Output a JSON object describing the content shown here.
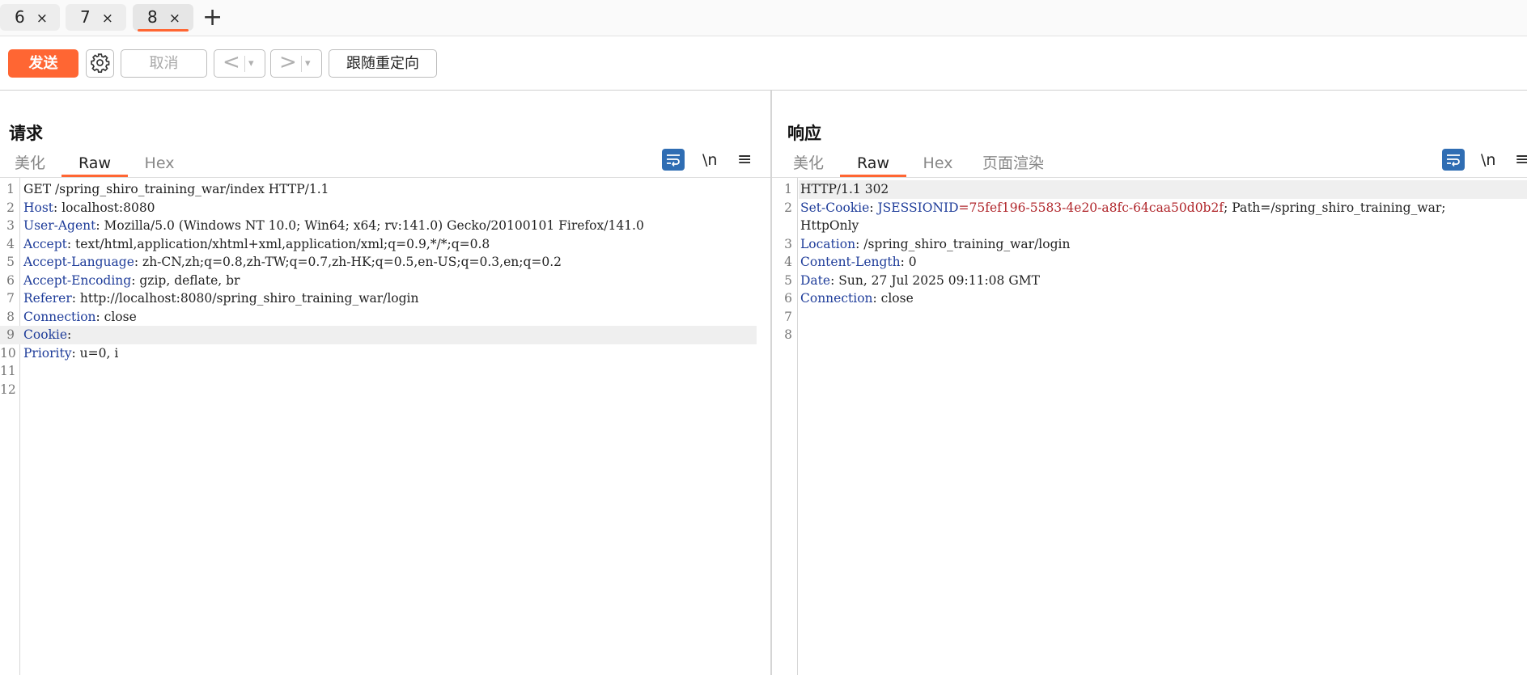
{
  "tabs": [
    {
      "label": "6",
      "close": "×"
    },
    {
      "label": "7",
      "close": "×"
    },
    {
      "label": "8",
      "close": "×"
    }
  ],
  "tab_add": "+",
  "toolbar": {
    "send": "发送",
    "cancel": "取消",
    "back": "<",
    "forward": ">",
    "dropdown": "▾",
    "follow_redirect": "跟随重定向"
  },
  "request": {
    "title": "请求",
    "tabs": [
      "美化",
      "Raw",
      "Hex"
    ],
    "active_tab": "Raw",
    "newline_label": "\\n",
    "menu_label": "≡",
    "lines": [
      {
        "n": "1",
        "text": "GET /spring_shiro_training_war/index HTTP/1.1"
      },
      {
        "n": "2",
        "key": "Host",
        "sep": ": ",
        "value": "localhost:8080"
      },
      {
        "n": "3",
        "key": "User-Agent",
        "sep": ": ",
        "value": "Mozilla/5.0 (Windows NT 10.0; Win64; x64; rv:141.0) Gecko/20100101 Firefox/141.0"
      },
      {
        "n": "4",
        "key": "Accept",
        "sep": ": ",
        "value": "text/html,application/xhtml+xml,application/xml;q=0.9,*/*;q=0.8"
      },
      {
        "n": "5",
        "key": "Accept-Language",
        "sep": ": ",
        "value": "zh-CN,zh;q=0.8,zh-TW;q=0.7,zh-HK;q=0.5,en-US;q=0.3,en;q=0.2"
      },
      {
        "n": "6",
        "key": "Accept-Encoding",
        "sep": ": ",
        "value": "gzip, deflate, br"
      },
      {
        "n": "7",
        "key": "Referer",
        "sep": ": ",
        "value": "http://localhost:8080/spring_shiro_training_war/login"
      },
      {
        "n": "8",
        "key": "Connection",
        "sep": ": ",
        "value": "close"
      },
      {
        "n": "9",
        "key": "Cookie",
        "sep": ":",
        "value": ""
      },
      {
        "n": "10",
        "key": "Priority",
        "sep": ": ",
        "value": "u=0, i"
      },
      {
        "n": "11",
        "text": ""
      },
      {
        "n": "12",
        "text": ""
      }
    ]
  },
  "response": {
    "title": "响应",
    "tabs": [
      "美化",
      "Raw",
      "Hex",
      "页面渲染"
    ],
    "active_tab": "Raw",
    "newline_label": "\\n",
    "menu_label": "≡",
    "lines": [
      {
        "n": "1",
        "text": "HTTP/1.1 302"
      },
      {
        "n": "2",
        "key": "Set-Cookie",
        "sep": ": ",
        "cookie_name": "JSESSIONID",
        "cookie_eq": "=",
        "cookie_value": "75fef196-5583-4e20-a8fc-64caa50d0b2f",
        "tail": "; Path=/spring_shiro_training_war;"
      },
      {
        "n": "",
        "text": "HttpOnly"
      },
      {
        "n": "3",
        "key": "Location",
        "sep": ": ",
        "value": "/spring_shiro_training_war/login"
      },
      {
        "n": "4",
        "key": "Content-Length",
        "sep": ": ",
        "value": "0"
      },
      {
        "n": "5",
        "key": "Date",
        "sep": ": ",
        "value": "Sun, 27 Jul 2025 09:11:08 GMT"
      },
      {
        "n": "6",
        "key": "Connection",
        "sep": ": ",
        "value": "close"
      },
      {
        "n": "7",
        "text": ""
      },
      {
        "n": "8",
        "text": ""
      }
    ]
  },
  "colors": {
    "accent": "#ff6633",
    "blue": "#2f6db3",
    "header_key": "#1f3d9a",
    "cookie_value": "#b0262b"
  }
}
